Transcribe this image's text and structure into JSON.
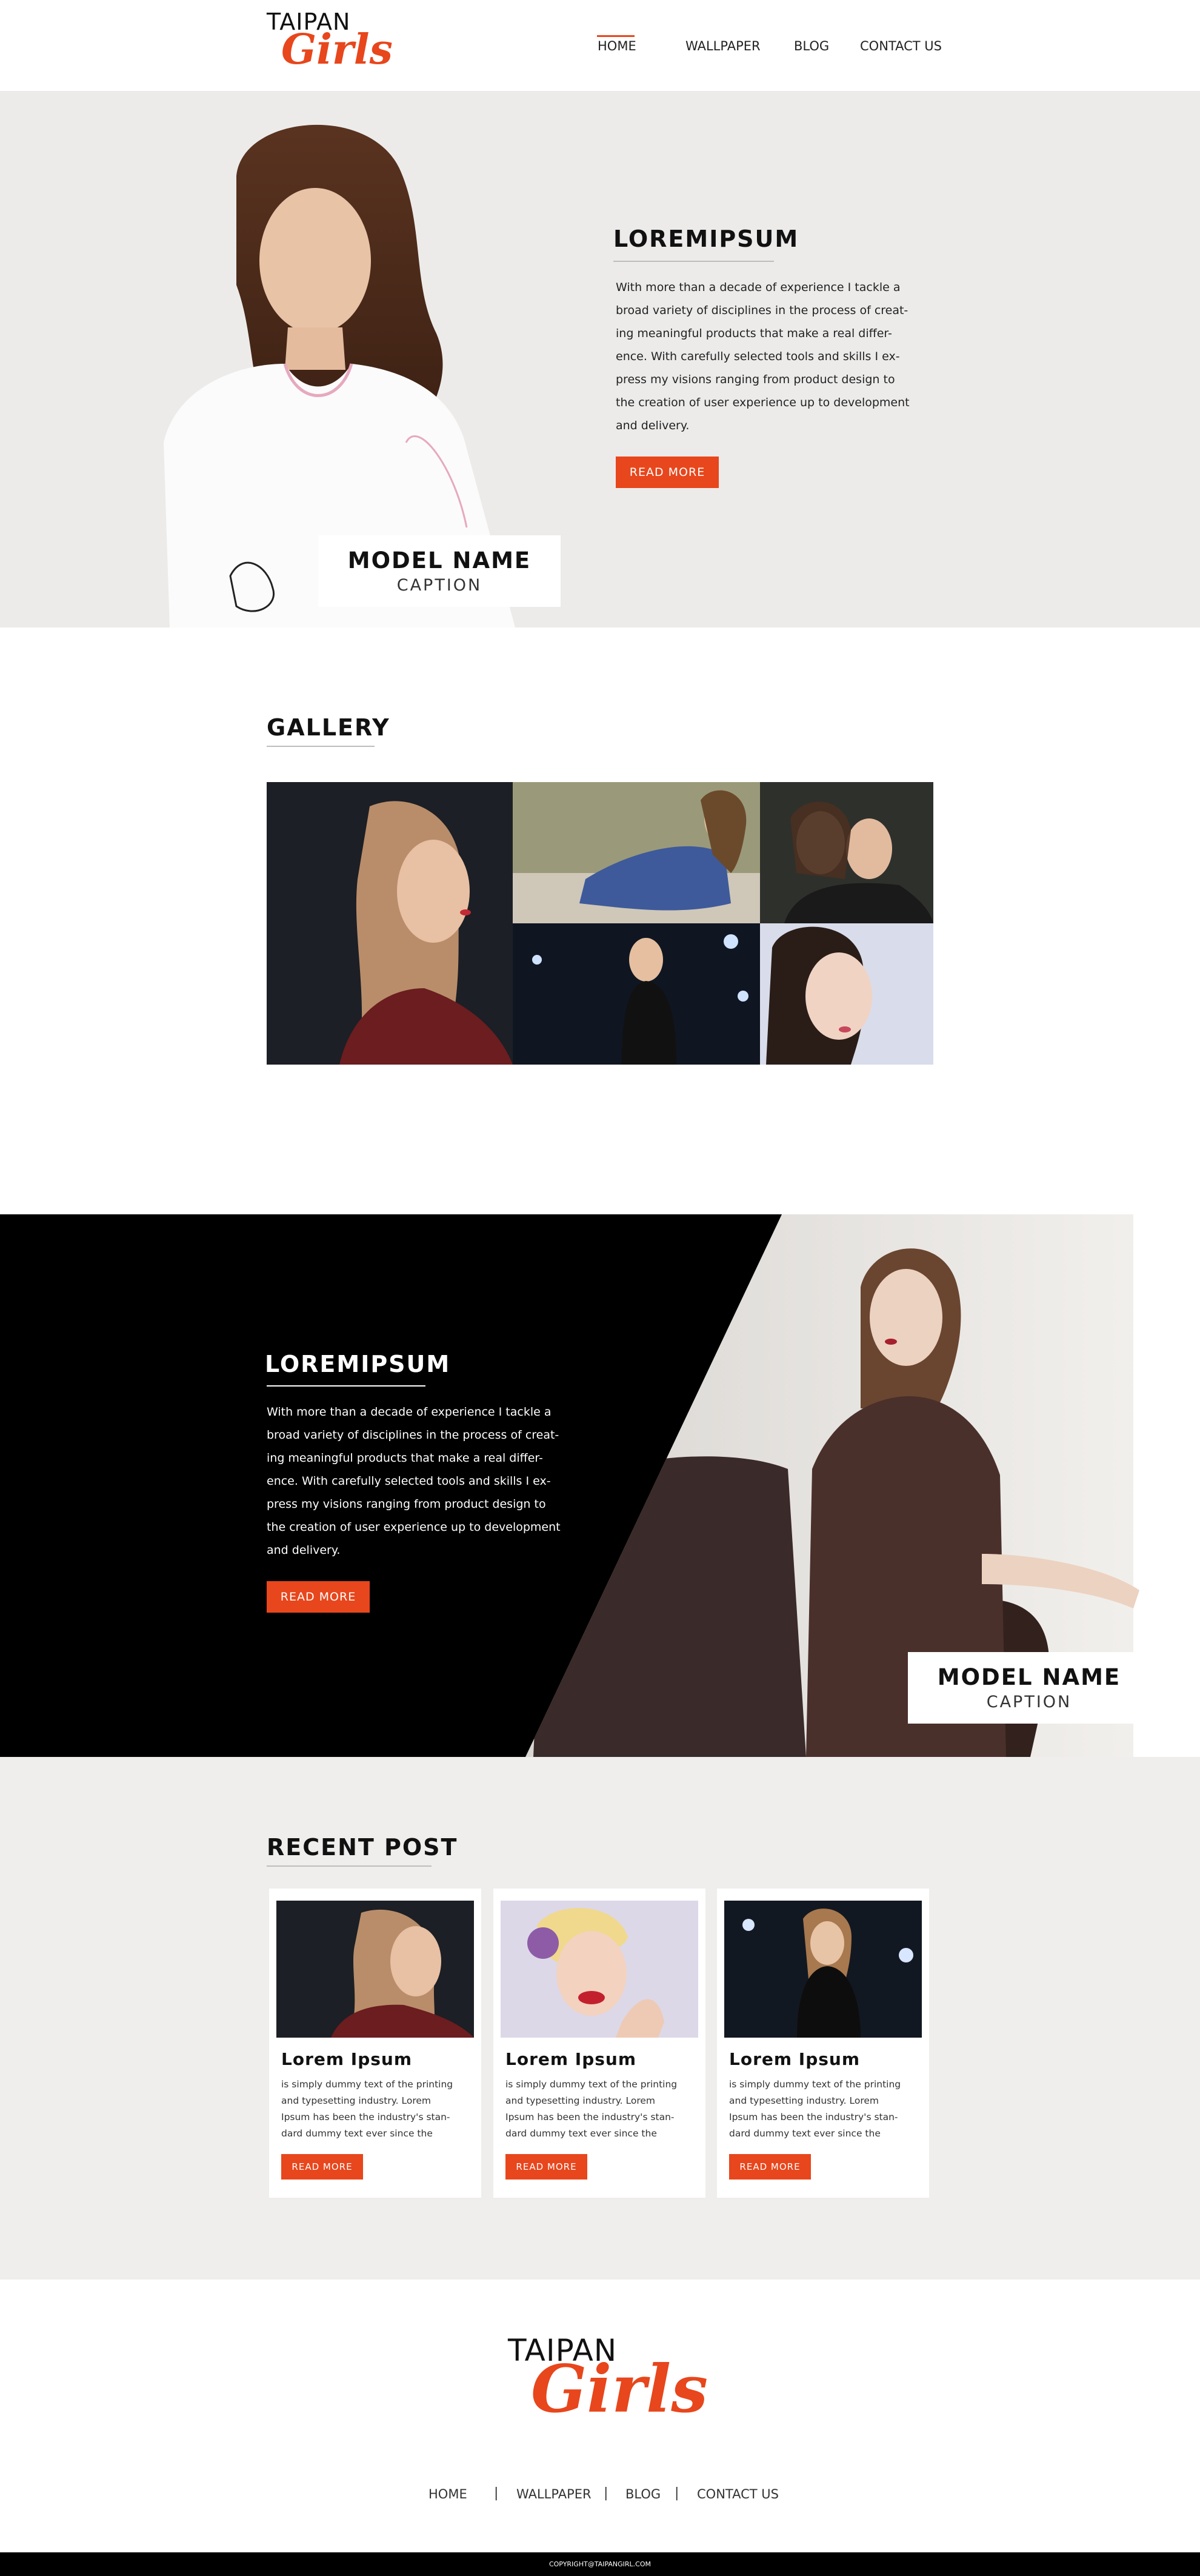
{
  "brand": {
    "top": "TAIPAN",
    "script": "Girls",
    "accent_color": "#e8461c"
  },
  "nav": {
    "items": [
      "HOME",
      "WALLPAPER",
      "BLOG",
      "CONTACT US"
    ],
    "active": "HOME"
  },
  "hero": {
    "title": "LOREMIPSUM",
    "paragraph_lines": [
      "With more than a decade of experience I tackle a",
      "broad variety of disciplines in the process of creat-",
      "ing meaningful products that make a real differ-",
      "ence. With carefully selected tools and skills I ex-",
      "press my visions ranging from product design to",
      "the creation of user experience up to development",
      "and delivery."
    ],
    "button_label": "READ MORE",
    "caption_name": "MODEL NAME",
    "caption_sub": "CAPTION"
  },
  "gallery": {
    "title": "GALLERY"
  },
  "feature": {
    "title": "LOREMIPSUM",
    "paragraph_lines": [
      "With more than a decade of experience I tackle a",
      "broad variety of disciplines in the process of creat-",
      "ing meaningful products that make a real differ-",
      "ence. With carefully selected tools and skills I ex-",
      "press my visions ranging from product design to",
      "the creation of user experience up to development",
      "and delivery."
    ],
    "button_label": "READ MORE",
    "caption_name": "MODEL NAME",
    "caption_sub": "CAPTION"
  },
  "recent": {
    "title": "RECENT POST",
    "posts": [
      {
        "title": "Lorem Ipsum",
        "lines": [
          "is simply dummy text of the printing",
          "and typesetting industry. Lorem",
          "Ipsum has been the industry's stan-",
          "dard dummy text ever since the"
        ],
        "button_label": "READ MORE"
      },
      {
        "title": "Lorem Ipsum",
        "lines": [
          "is simply dummy text of the printing",
          "and typesetting industry. Lorem",
          "Ipsum has been the industry's stan-",
          "dard dummy text ever since the"
        ],
        "button_label": "READ MORE"
      },
      {
        "title": "Lorem Ipsum",
        "lines": [
          "is simply dummy text of the printing",
          "and typesetting industry. Lorem",
          "Ipsum has been the industry's stan-",
          "dard dummy text ever since the"
        ],
        "button_label": "READ MORE"
      }
    ]
  },
  "footer": {
    "brand_top": "TAIPAN",
    "brand_script": "Girls",
    "links": [
      "HOME",
      "WALLPAPER",
      "BLOG",
      "CONTACT US"
    ],
    "separator": "|",
    "copyright": "COPYRIGHT@TAIPANGIRL.COM"
  }
}
